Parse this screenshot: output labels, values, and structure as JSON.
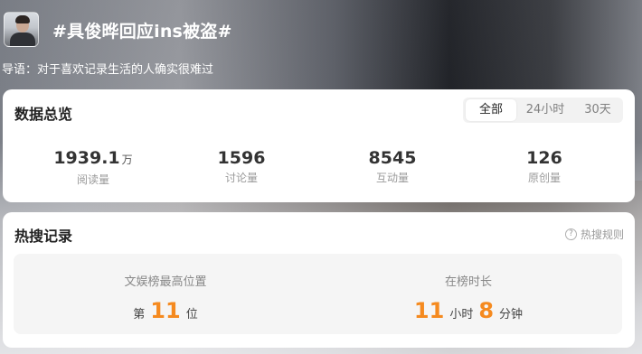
{
  "header": {
    "topic_title": "#具俊晔回应ins被盗#",
    "guide": "导语：对于喜欢记录生活的人确实很难过"
  },
  "overview": {
    "title": "数据总览",
    "tabs": [
      {
        "label": "全部",
        "active": true
      },
      {
        "label": "24小时",
        "active": false
      },
      {
        "label": "30天",
        "active": false
      }
    ],
    "stats": [
      {
        "value": "1939.1",
        "unit": "万",
        "label": "阅读量"
      },
      {
        "value": "1596",
        "unit": "",
        "label": "讨论量"
      },
      {
        "value": "8545",
        "unit": "",
        "label": "互动量"
      },
      {
        "value": "126",
        "unit": "",
        "label": "原创量"
      }
    ]
  },
  "hot_search": {
    "title": "热搜记录",
    "rules_label": "热搜规则",
    "rules_icon": "question-circle-icon",
    "highest_position": {
      "label": "文娱榜最高位置",
      "prefix": "第",
      "value": "11",
      "suffix": "位"
    },
    "duration": {
      "label": "在榜时长",
      "hours": "11",
      "hours_unit": "小时",
      "minutes": "8",
      "minutes_unit": "分钟"
    }
  },
  "colors": {
    "accent_orange": "#f58a1f",
    "card_bg": "#ffffff",
    "inner_bg": "#f5f5f5"
  }
}
